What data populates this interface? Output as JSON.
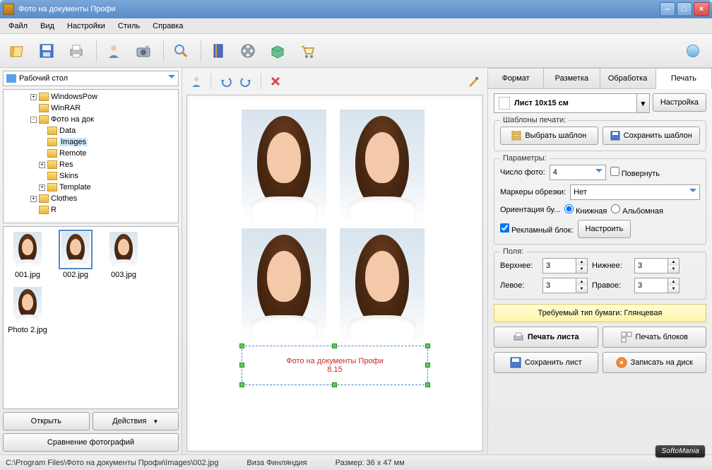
{
  "titlebar": {
    "title": "Фото на документы Профи"
  },
  "menu": [
    "Файл",
    "Вид",
    "Настройки",
    "Стиль",
    "Справка"
  ],
  "left": {
    "path": "Рабочий стол",
    "tree": [
      {
        "depth": 3,
        "expand": "+",
        "label": "WindowsPow"
      },
      {
        "depth": 3,
        "expand": "",
        "label": "WinRAR"
      },
      {
        "depth": 3,
        "expand": "-",
        "label": "Фото на док"
      },
      {
        "depth": 4,
        "expand": "",
        "label": "Data"
      },
      {
        "depth": 4,
        "expand": "",
        "label": "Images",
        "selected": true
      },
      {
        "depth": 4,
        "expand": "",
        "label": "Remote"
      },
      {
        "depth": 4,
        "expand": "+",
        "label": "Res"
      },
      {
        "depth": 4,
        "expand": "",
        "label": "Skins"
      },
      {
        "depth": 4,
        "expand": "+",
        "label": "Template"
      },
      {
        "depth": 3,
        "expand": "+",
        "label": "Clothes"
      },
      {
        "depth": 3,
        "expand": "",
        "label": "R"
      }
    ],
    "thumbs": [
      {
        "name": "001.jpg"
      },
      {
        "name": "002.jpg",
        "selected": true
      },
      {
        "name": "003.jpg"
      },
      {
        "name": "Photo 2.jpg"
      }
    ],
    "open": "Открыть",
    "actions": "Действия",
    "compare": "Сравнение фотографий"
  },
  "canvas": {
    "watermark_title": "Фото на документы Профи",
    "watermark_version": "8.15"
  },
  "right": {
    "tabs": [
      "Формат",
      "Разметка",
      "Обработка",
      "Печать"
    ],
    "active_tab": 3,
    "sheet_label": "Лист 10x15 см",
    "setup": "Настройка",
    "templates": {
      "legend": "Шаблоны печати:",
      "choose": "Выбрать шаблон",
      "save": "Сохранить шаблон"
    },
    "params": {
      "legend": "Параметры:",
      "count_label": "Число фото:",
      "count": "4",
      "rotate": "Повернуть",
      "crop_label": "Маркеры обрезки:",
      "crop_value": "Нет",
      "orient_label": "Ориентация бу...",
      "orient_portrait": "Книжная",
      "orient_landscape": "Альбомная",
      "ad_block": "Рекламный блок:",
      "configure": "Настроить"
    },
    "margins": {
      "legend": "Поля:",
      "top": "Верхнее:",
      "bottom": "Нижнее:",
      "left": "Левое:",
      "right": "Правое:",
      "top_v": "3",
      "bottom_v": "3",
      "left_v": "3",
      "right_v": "3"
    },
    "paper": "Требуемый тип бумаги: Глянцевая",
    "actions": {
      "print_sheet": "Печать листа",
      "print_blocks": "Печать блоков",
      "save_sheet": "Сохранить лист",
      "write_disc": "Записать на диск"
    }
  },
  "status": {
    "path": "C:\\Program Files\\Фото на документы Профи\\Images\\002.jpg",
    "visa": "Виза Финляндия",
    "size": "Размер: 36 x 47 мм"
  },
  "brand": "SoftoMania"
}
